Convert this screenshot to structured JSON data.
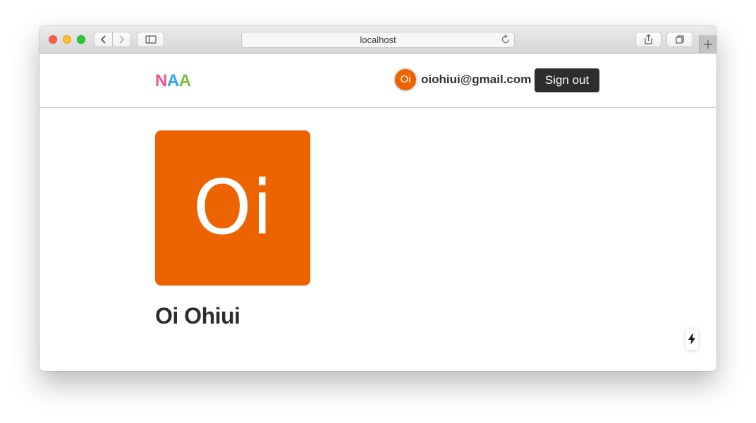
{
  "browser": {
    "url": "localhost"
  },
  "header": {
    "logo": [
      "N",
      "A",
      "A"
    ],
    "logo_colors": [
      "#f2528a",
      "#2aa8ef",
      "#7cbd43"
    ],
    "avatar_initials": "Oi",
    "email": "oiohiui@gmail.com",
    "signout_label": "Sign out"
  },
  "profile": {
    "avatar_initials": "Oi",
    "avatar_color": "#ed6300",
    "name": "Oi Ohiui"
  },
  "icons": {
    "floating_button": "lightning-bolt-icon"
  }
}
